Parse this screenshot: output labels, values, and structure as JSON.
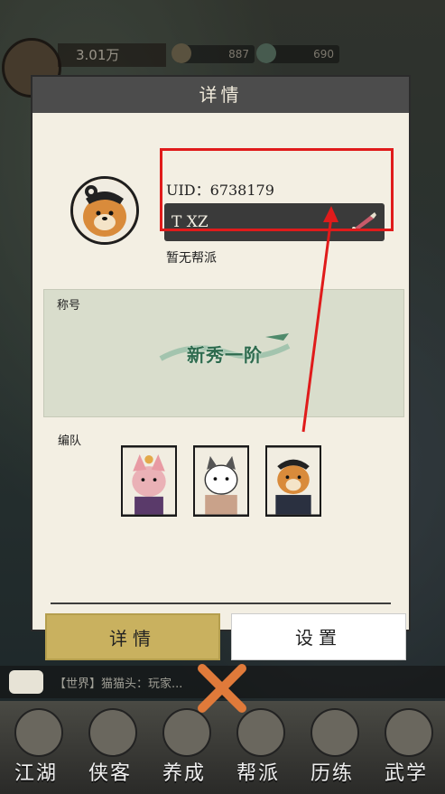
{
  "topbar": {
    "money": "3.01万",
    "resource1": "887",
    "resource2": "690"
  },
  "dialog": {
    "title": "详情",
    "uid": "UID：6738179",
    "player_name": "T XZ",
    "guild": "暂无帮派",
    "title_section_label": "称号",
    "title_badge_text": "新秀一阶",
    "team_label": "编队",
    "buttons": {
      "detail": "详情",
      "settings": "设置"
    }
  },
  "chat": {
    "text": "【世界】猫猫头：玩家..."
  },
  "nav": {
    "items": [
      {
        "label": "江湖",
        "icon": "book-icon"
      },
      {
        "label": "侠客",
        "icon": "hero-icon"
      },
      {
        "label": "养成",
        "icon": "scroll-icon"
      },
      {
        "label": "帮派",
        "icon": "guild-icon"
      },
      {
        "label": "历练",
        "icon": "sword-icon"
      },
      {
        "label": "武学",
        "icon": "manual-icon"
      }
    ]
  },
  "colors": {
    "highlight": "#e01b1b",
    "primary_button": "#c9b15f",
    "header": "#4c4c4c"
  }
}
